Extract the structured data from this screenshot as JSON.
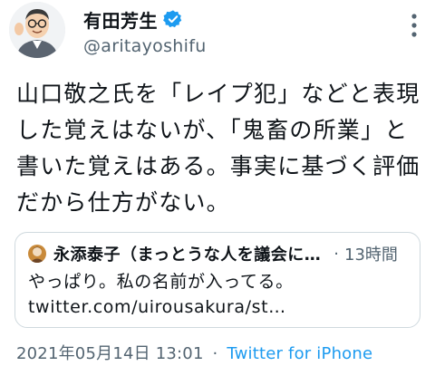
{
  "tweet": {
    "author": {
      "display_name": "有田芳生",
      "handle": "@aritayoshifu",
      "verified_icon": "verified-badge-icon",
      "avatar_icon": "user-avatar-illustration"
    },
    "more_icon": "more-options-icon",
    "text": "山口敬之氏を「レイプ犯」などと表現した覚えはないが、「鬼畜の所業」と書いた覚えはある。事実に基づく評価だから仕方がない。",
    "quote": {
      "avatar_icon": "quoted-user-avatar",
      "display_name": "永添泰子（まっとうな人を議会に…",
      "separator": "·",
      "time": "13時間",
      "text": "やっぱり。私の名前が入ってる。 twitter.com/uirousakura/st…"
    },
    "meta": {
      "timestamp": "2021年05月14日 13:01",
      "separator": "·",
      "source": "Twitter for iPhone"
    }
  },
  "colors": {
    "text_primary": "#0f1419",
    "text_secondary": "#536471",
    "accent": "#1d9bf0",
    "border": "#cfd9de"
  }
}
